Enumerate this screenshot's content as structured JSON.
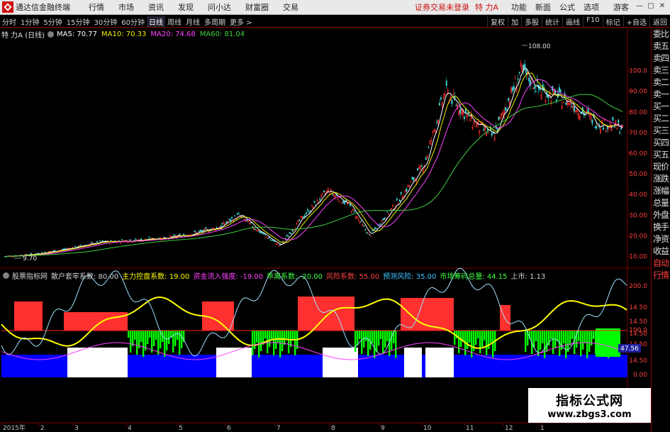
{
  "app": {
    "title": "通达信金融终端",
    "menu": [
      "行情",
      "市场",
      "资讯",
      "发现",
      "问小达",
      "财富圈",
      "交易"
    ],
    "login_status": "证券交易未登录",
    "stock_name": "特 力A",
    "right_menu": [
      "功能",
      "新面",
      "公式",
      "选项"
    ],
    "guest": "游客",
    "window_buttons": [
      "—",
      "▢",
      "✕"
    ]
  },
  "periods": [
    "分时",
    "1分钟",
    "5分钟",
    "15分钟",
    "30分钟",
    "60分钟",
    "日线",
    "周线",
    "月线",
    "多周期",
    "更多 >"
  ],
  "active_period": "日线",
  "toolbar_right": [
    "复权",
    "加",
    "多股",
    "统计",
    "画线",
    "F10",
    "标记",
    "+自选",
    "返回"
  ],
  "tag": "L\n800",
  "main_header": {
    "name": "特 力A (日线)",
    "ma5": "MA5: 70.77",
    "ma10": "MA10: 70.33",
    "ma20": "MA20: 74.68",
    "ma60": "MA60: 81.04"
  },
  "sub_header": [
    {
      "t": "股票指标网",
      "c": "#d0d0d0"
    },
    {
      "t": "散户套牢系数: 80.00",
      "c": "#d0d0d0"
    },
    {
      "t": "主力控盘系数: 19.00",
      "c": "#ffff00"
    },
    {
      "t": "资金流入强度: -19.00",
      "c": "#ff40ff"
    },
    {
      "t": "乖离系数: -20.00",
      "c": "#40ff40"
    },
    {
      "t": "风险系数: 55.00",
      "c": "#ff4040"
    },
    {
      "t": "预测风险: 35.00",
      "c": "#40c0ff"
    },
    {
      "t": "市场筹码总量: 44.15",
      "c": "#40ff40"
    },
    {
      "t": "上市: 1.13",
      "c": "#d0d0d0"
    }
  ],
  "price_axis": [
    "100.0",
    "90.00",
    "80.00",
    "70.00",
    "60.00",
    "50.00",
    "40.00",
    "30.00",
    "20.00",
    "10.00"
  ],
  "ind_axis": [
    "200.0",
    "14.50",
    "14.50",
    "14.50",
    "100.0",
    "14.50",
    "14.50",
    "0.00"
  ],
  "ind_current": "47.56",
  "peak_label": "108.00",
  "low_label": "9.70",
  "bottom_labels": [
    "2015年",
    "2",
    "3",
    "4",
    "5",
    "6",
    "7",
    "8",
    "9",
    "10",
    "11",
    "12",
    "1"
  ],
  "bottom_mark": "1",
  "side_items": [
    "委比",
    "卖五",
    "卖四",
    "卖三",
    "卖二",
    "卖一",
    "买一",
    "买二",
    "买三",
    "买四",
    "买五",
    "现价",
    "涨跌",
    "涨幅",
    "总量",
    "外盘",
    "换手",
    "净资",
    "收益",
    "自动",
    "行情"
  ],
  "watermark": {
    "line1": "指标公式网",
    "line2": "www.zbgs3.com"
  },
  "colors": {
    "up": "#ff3030",
    "down": "#40e0e0",
    "ma5": "#ffffff",
    "ma10": "#f0f000",
    "ma20": "#ff40ff",
    "ma60": "#40d040",
    "axis": "#800000"
  }
}
